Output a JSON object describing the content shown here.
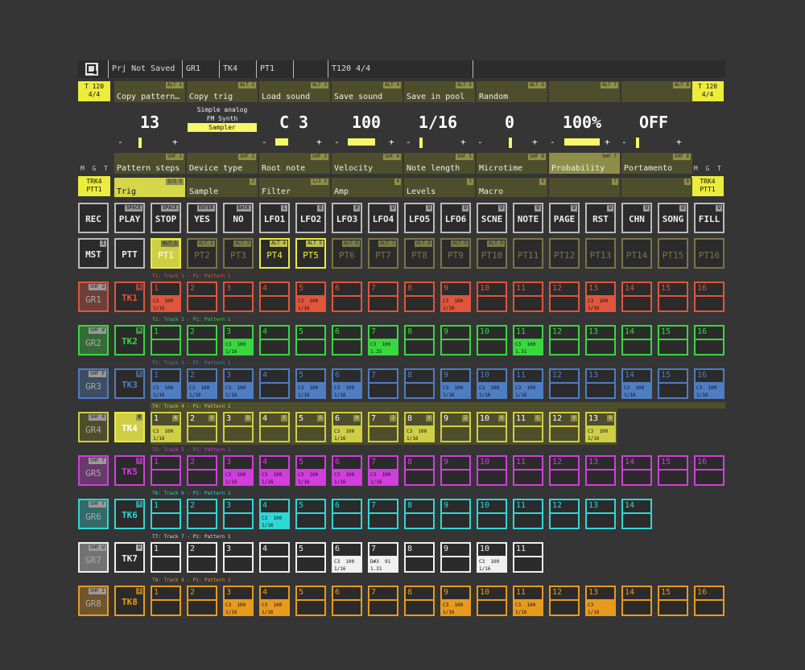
{
  "top_bar": {
    "search_icon": "search-icon",
    "project": "Prj Not Saved",
    "group": "GR1",
    "track": "TK4",
    "pattern": "PT1",
    "tempo": "T120 4/4"
  },
  "left_tempo": {
    "line1": "T 120",
    "line2": "4/4"
  },
  "right_tempo": {
    "line1": "T 120",
    "line2": "4/4"
  },
  "encoder_headers": [
    {
      "key": "ALT 1",
      "label": "Copy pattern…"
    },
    {
      "key": "ALT 2",
      "label": "Copy trig"
    },
    {
      "key": "ALT 3",
      "label": "Load sound"
    },
    {
      "key": "ALT 4",
      "label": "Save sound"
    },
    {
      "key": "ALT 5",
      "label": "Save in pool"
    },
    {
      "key": "ALT 6",
      "label": "Random"
    },
    {
      "key": "ALT 7",
      "label": ""
    },
    {
      "key": "ALT 8",
      "label": ""
    }
  ],
  "values": {
    "pattern_steps": "13",
    "device_types": [
      "Simple analog",
      "FM Synth",
      "Sampler"
    ],
    "root_note": "C 3",
    "velocity": "100",
    "note_length": "1/16",
    "microtime": "0",
    "probability": "100%",
    "portamento": "OFF",
    "minus": "-",
    "plus": "+"
  },
  "mgt": {
    "m": "M",
    "g": "G",
    "t": "T"
  },
  "param_headers": [
    {
      "key": "SHF 1",
      "label": "Pattern steps"
    },
    {
      "key": "SHF 2",
      "label": "Device type"
    },
    {
      "key": "SHF 3",
      "label": "Root note"
    },
    {
      "key": "SHF 4",
      "label": "Velocity"
    },
    {
      "key": "SHF 5",
      "label": "Note length"
    },
    {
      "key": "SHF 6",
      "label": "Microtime"
    },
    {
      "key": "SHF 7",
      "label": "Probability"
    },
    {
      "key": "SHF 8",
      "label": "Portamento"
    }
  ],
  "trk_left": {
    "line1": "TRK4",
    "line2": "PTT1"
  },
  "trk_right": {
    "line1": "TRK4",
    "line2": "PTT1"
  },
  "tabs": [
    {
      "key": "1/2 1",
      "label": "Trig"
    },
    {
      "key": "2",
      "label": "Sample"
    },
    {
      "key": "1/2 3",
      "label": "Filter"
    },
    {
      "key": "4",
      "label": "Amp"
    },
    {
      "key": "5",
      "label": "Levels"
    },
    {
      "key": "6",
      "label": "Macro"
    },
    {
      "key": "7",
      "label": ""
    },
    {
      "key": "8",
      "label": ""
    }
  ],
  "buttons": [
    {
      "label": "REC",
      "key": ""
    },
    {
      "label": "PLAY",
      "key": "SPACE"
    },
    {
      "label": "STOP",
      "key": "SPACE"
    },
    {
      "label": "YES",
      "key": "ENTER"
    },
    {
      "label": "NO",
      "key": "BACK"
    },
    {
      "label": "LFO1",
      "key": "L"
    },
    {
      "label": "LFO2",
      "key": "Q"
    },
    {
      "label": "LFO3",
      "key": "#"
    },
    {
      "label": "LFO4",
      "key": "U"
    },
    {
      "label": "LFO5",
      "key": "U"
    },
    {
      "label": "LFO6",
      "key": "U"
    },
    {
      "label": "SCNE",
      "key": "U"
    },
    {
      "label": "NOTE",
      "key": "U"
    },
    {
      "label": "PAGE",
      "key": "U"
    },
    {
      "label": "RST",
      "key": "U"
    },
    {
      "label": "CHN",
      "key": "U"
    },
    {
      "label": "SONG",
      "key": "U"
    },
    {
      "label": "FILL",
      "key": "U"
    }
  ],
  "mst": {
    "label": "MST",
    "key": "I"
  },
  "ptt": {
    "label": "PTT"
  },
  "patterns": [
    {
      "label": "PT1",
      "key": "ALT 1"
    },
    {
      "label": "PT2",
      "key": "ALT 2"
    },
    {
      "label": "PT3",
      "key": "ALT 3"
    },
    {
      "label": "PT4",
      "key": "ALT 4"
    },
    {
      "label": "PT5",
      "key": "ALT 5"
    },
    {
      "label": "PT6",
      "key": "ALT 6"
    },
    {
      "label": "PT7",
      "key": "ALT 7"
    },
    {
      "label": "PT8",
      "key": "ALT 8"
    },
    {
      "label": "PT9",
      "key": "ALT 9"
    },
    {
      "label": "PT10",
      "key": "ALT 0"
    },
    {
      "label": "PT11",
      "key": ""
    },
    {
      "label": "PT12",
      "key": ""
    },
    {
      "label": "PT13",
      "key": ""
    },
    {
      "label": "PT14",
      "key": ""
    },
    {
      "label": "PT15",
      "key": ""
    },
    {
      "label": "PT16",
      "key": ""
    }
  ],
  "colors": {
    "yellow": "#ecec3c",
    "red": "#e0553c",
    "green": "#39d73f",
    "blue": "#4f7dc2",
    "olive": "#cfcf46",
    "magenta": "#d23ede",
    "cyan": "#2fd7d7",
    "white": "#f0f0f0",
    "orange": "#e89a1e"
  },
  "tracks": [
    {
      "group": "GR1",
      "gkey": "SHF Q",
      "track": "TK1",
      "tkey": "Q",
      "label": "T1: Track 1 - P1: Pattern 1",
      "steps": [
        {
          "n": "1",
          "note": "C3  100",
          "len": "1/16"
        },
        {
          "n": "2"
        },
        {
          "n": "3"
        },
        {
          "n": "4"
        },
        {
          "n": "5",
          "note": "C3  100",
          "len": "1/16"
        },
        {
          "n": "6"
        },
        {
          "n": "7"
        },
        {
          "n": "8"
        },
        {
          "n": "9",
          "note": "C3  100",
          "len": "1/16"
        },
        {
          "n": "10"
        },
        {
          "n": "11"
        },
        {
          "n": "12"
        },
        {
          "n": "13",
          "note": "C3  100",
          "len": "1/16"
        },
        {
          "n": "14"
        },
        {
          "n": "15"
        },
        {
          "n": "16"
        }
      ]
    },
    {
      "group": "GR2",
      "gkey": "SHF W",
      "track": "TK2",
      "tkey": "W",
      "label": "T2: Track 2 - P1: Pattern 1",
      "steps": [
        {
          "n": "1"
        },
        {
          "n": "2"
        },
        {
          "n": "3",
          "note": "C3  100",
          "len": "1/16"
        },
        {
          "n": "4"
        },
        {
          "n": "5"
        },
        {
          "n": "6"
        },
        {
          "n": "7",
          "note": "C3  100",
          "len": "1.25"
        },
        {
          "n": "8"
        },
        {
          "n": "9"
        },
        {
          "n": "10"
        },
        {
          "n": "11",
          "note": "C3  100",
          "len": "1.31"
        },
        {
          "n": "12"
        },
        {
          "n": "13"
        },
        {
          "n": "14"
        },
        {
          "n": "15"
        },
        {
          "n": "16"
        }
      ]
    },
    {
      "group": "GR3",
      "gkey": "SHF E",
      "track": "TK3",
      "tkey": "E",
      "label": "T3: Track 3 - P1: Pattern 1",
      "steps": [
        {
          "n": "1",
          "note": "C3  100",
          "len": "1/16"
        },
        {
          "n": "2",
          "note": "C3  100",
          "len": "1/16"
        },
        {
          "n": "3",
          "note": "C3  100",
          "len": "1/16"
        },
        {
          "n": "4"
        },
        {
          "n": "5",
          "note": "C3  100",
          "len": "1/16"
        },
        {
          "n": "6",
          "note": "C3  100",
          "len": "1/16"
        },
        {
          "n": "7"
        },
        {
          "n": "8"
        },
        {
          "n": "9",
          "note": "C3  100",
          "len": "1/16"
        },
        {
          "n": "10",
          "note": "C3  100",
          "len": "1/16"
        },
        {
          "n": "11",
          "note": "C3  100",
          "len": "1/16"
        },
        {
          "n": "12"
        },
        {
          "n": "13"
        },
        {
          "n": "14",
          "note": "C3  100",
          "len": "1/16"
        },
        {
          "n": "15"
        },
        {
          "n": "16",
          "note": "C3  100",
          "len": "1/16"
        }
      ]
    },
    {
      "group": "GR4",
      "gkey": "SHF R",
      "track": "TK4",
      "tkey": "R",
      "label": "T4: Track 4 - P1: Pattern 1",
      "steps": [
        {
          "n": "1",
          "k": "A",
          "note": "C3  100",
          "len": "1/16"
        },
        {
          "n": "2",
          "k": "S"
        },
        {
          "n": "3",
          "k": "D"
        },
        {
          "n": "4",
          "k": "F"
        },
        {
          "n": "5",
          "k": "G"
        },
        {
          "n": "6",
          "k": "H",
          "note": "C3  100",
          "len": "1/16"
        },
        {
          "n": "7",
          "k": "J"
        },
        {
          "n": "8",
          "k": "X",
          "note": "C3  100",
          "len": "1/16"
        },
        {
          "n": "9",
          "k": "Z"
        },
        {
          "n": "10",
          "k": "X"
        },
        {
          "n": "11",
          "k": "C"
        },
        {
          "n": "12",
          "k": "V"
        },
        {
          "n": "13",
          "k": "B",
          "note": "C3  100",
          "len": "1/16"
        }
      ]
    },
    {
      "group": "GR5",
      "gkey": "SHF T",
      "track": "TK5",
      "tkey": "T",
      "label": "T5: Track 5 - P1: Pattern 1",
      "steps": [
        {
          "n": "1"
        },
        {
          "n": "2"
        },
        {
          "n": "3",
          "note": "C3  100",
          "len": "1/16"
        },
        {
          "n": "4",
          "note": "C3  100",
          "len": "1/16"
        },
        {
          "n": "5",
          "note": "C3  100",
          "len": "1/16"
        },
        {
          "n": "6",
          "note": "C3  100",
          "len": "1/16"
        },
        {
          "n": "7",
          "note": "C3  100",
          "len": "1/16"
        },
        {
          "n": "8"
        },
        {
          "n": "9"
        },
        {
          "n": "10"
        },
        {
          "n": "11"
        },
        {
          "n": "12"
        },
        {
          "n": "13"
        },
        {
          "n": "14"
        },
        {
          "n": "15"
        },
        {
          "n": "16"
        }
      ]
    },
    {
      "group": "GR6",
      "gkey": "SHF Y",
      "track": "TK6",
      "tkey": "Y",
      "label": "T6: Track 6 - P1: Pattern 1",
      "steps": [
        {
          "n": "1"
        },
        {
          "n": "2"
        },
        {
          "n": "3"
        },
        {
          "n": "4",
          "note": "C3  100",
          "len": "1/16"
        },
        {
          "n": "5"
        },
        {
          "n": "6"
        },
        {
          "n": "7"
        },
        {
          "n": "8"
        },
        {
          "n": "9"
        },
        {
          "n": "10"
        },
        {
          "n": "11"
        },
        {
          "n": "12"
        },
        {
          "n": "13"
        },
        {
          "n": "14"
        }
      ]
    },
    {
      "group": "GR7",
      "gkey": "SHF U",
      "track": "TK7",
      "tkey": "U",
      "label": "T7: Track 7 - P1: Pattern 1",
      "steps": [
        {
          "n": "1"
        },
        {
          "n": "2"
        },
        {
          "n": "3"
        },
        {
          "n": "4"
        },
        {
          "n": "5"
        },
        {
          "n": "6",
          "note": "C3  100",
          "len": "1/16"
        },
        {
          "n": "7",
          "note": "D#3  91",
          "len": "1.31"
        },
        {
          "n": "8"
        },
        {
          "n": "9"
        },
        {
          "n": "10",
          "note": "C3  100",
          "len": "1/16"
        },
        {
          "n": "11"
        }
      ]
    },
    {
      "group": "GR8",
      "gkey": "SHF I",
      "track": "TK8",
      "tkey": "I",
      "label": "T8: Track 8 - P1: Pattern 1",
      "steps": [
        {
          "n": "1"
        },
        {
          "n": "2"
        },
        {
          "n": "3",
          "note": "C3  100",
          "len": "1/16"
        },
        {
          "n": "4",
          "note": "C3  100",
          "len": "1/16"
        },
        {
          "n": "5"
        },
        {
          "n": "6"
        },
        {
          "n": "7"
        },
        {
          "n": "8"
        },
        {
          "n": "9",
          "note": "C3  100",
          "len": "1/16"
        },
        {
          "n": "10"
        },
        {
          "n": "11",
          "note": "C3  100",
          "len": "1/16"
        },
        {
          "n": "12"
        },
        {
          "n": "13",
          "note": "C3",
          "len": "1/16"
        },
        {
          "n": "14"
        },
        {
          "n": "15"
        },
        {
          "n": "16"
        }
      ]
    }
  ]
}
